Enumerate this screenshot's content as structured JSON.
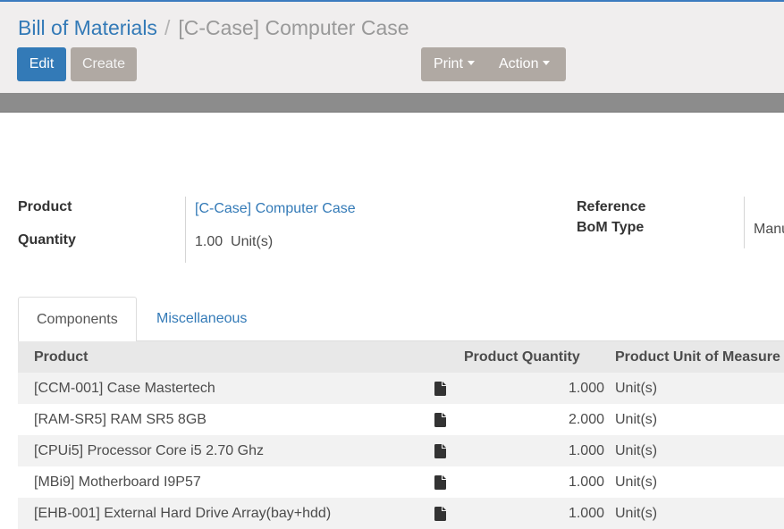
{
  "breadcrumb": {
    "parent": "Bill of Materials",
    "separator": "/",
    "current": "[C-Case] Computer Case"
  },
  "toolbar": {
    "edit_label": "Edit",
    "create_label": "Create",
    "print_label": "Print",
    "action_label": "Action"
  },
  "form": {
    "product_label": "Product",
    "product_value": "[C-Case] Computer Case",
    "quantity_label": "Quantity",
    "quantity_value": "1.00",
    "quantity_uom": "Unit(s)",
    "reference_label": "Reference",
    "bom_type_label": "BoM Type",
    "bom_type_value": "Manu"
  },
  "tabs": [
    {
      "label": "Components",
      "active": true
    },
    {
      "label": "Miscellaneous",
      "active": false
    }
  ],
  "table": {
    "headers": [
      "Product",
      "Product Quantity",
      "Product Unit of Measure"
    ],
    "rows": [
      {
        "product": "[CCM-001] Case Mastertech",
        "qty": "1.000",
        "uom": "Unit(s)"
      },
      {
        "product": "[RAM-SR5] RAM SR5 8GB",
        "qty": "2.000",
        "uom": "Unit(s)"
      },
      {
        "product": "[CPUi5] Processor Core i5 2.70 Ghz",
        "qty": "1.000",
        "uom": "Unit(s)"
      },
      {
        "product": "[MBi9] Motherboard I9P57",
        "qty": "1.000",
        "uom": "Unit(s)"
      },
      {
        "product": "[EHB-001] External Hard Drive Array(bay+hdd)",
        "qty": "1.000",
        "uom": "Unit(s)"
      }
    ],
    "row_icon": "file-icon"
  },
  "colors": {
    "accent": "#337ab7",
    "top_border": "#3b7bbf",
    "secondary_button": "#b0a9a3",
    "panel_bg": "#f0eeee"
  }
}
